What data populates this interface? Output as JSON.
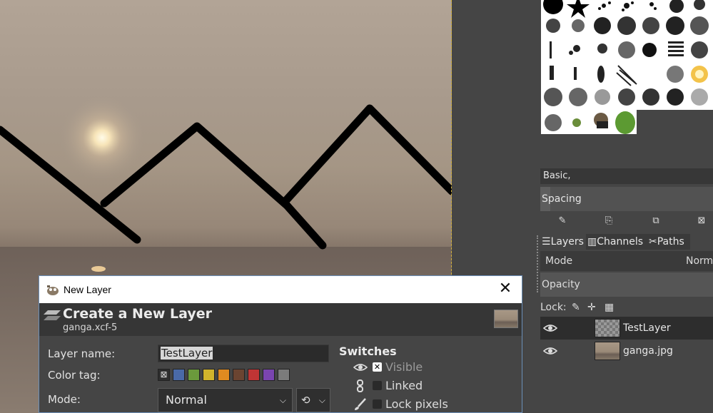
{
  "canvas": {
    "sky_color": "#a89a8c",
    "sun_color": "#fff8d6",
    "line_color": "#000000",
    "guide_color": "#d4b33a"
  },
  "brushes": {
    "preset_name": "Basic,",
    "spacing_label": "Spacing"
  },
  "dock_tabs": [
    {
      "label": "Layers",
      "icon": "layers-icon"
    },
    {
      "label": "Channels",
      "icon": "channels-icon"
    },
    {
      "label": "Paths",
      "icon": "paths-icon"
    }
  ],
  "layers_panel": {
    "mode_label": "Mode",
    "mode_value": "Norm",
    "opacity_label": "Opacity",
    "lock_label": "Lock:",
    "layers": [
      {
        "name": "TestLayer",
        "selected": true
      },
      {
        "name": "ganga.jpg",
        "selected": false
      }
    ]
  },
  "dialog": {
    "title": "New Layer",
    "heading": "Create a New Layer",
    "subheading": "ganga.xcf-5",
    "layer_name_label": "Layer name:",
    "layer_name_value": "TestLayer",
    "color_tag_label": "Color tag:",
    "color_tags": [
      "none",
      "#4a6aa8",
      "#6b9a3c",
      "#d2b42c",
      "#e08a20",
      "#6b4431",
      "#c03535",
      "#7a45b0",
      "#7b7b7b"
    ],
    "mode_label": "Mode:",
    "mode_value": "Normal",
    "switches_title": "Switches",
    "switches": [
      {
        "label": "Visible",
        "checked": true,
        "icon": "eye-icon"
      },
      {
        "label": "Linked",
        "checked": false,
        "icon": "chain-icon"
      },
      {
        "label": "Lock pixels",
        "checked": false,
        "icon": "brush-icon"
      }
    ]
  }
}
